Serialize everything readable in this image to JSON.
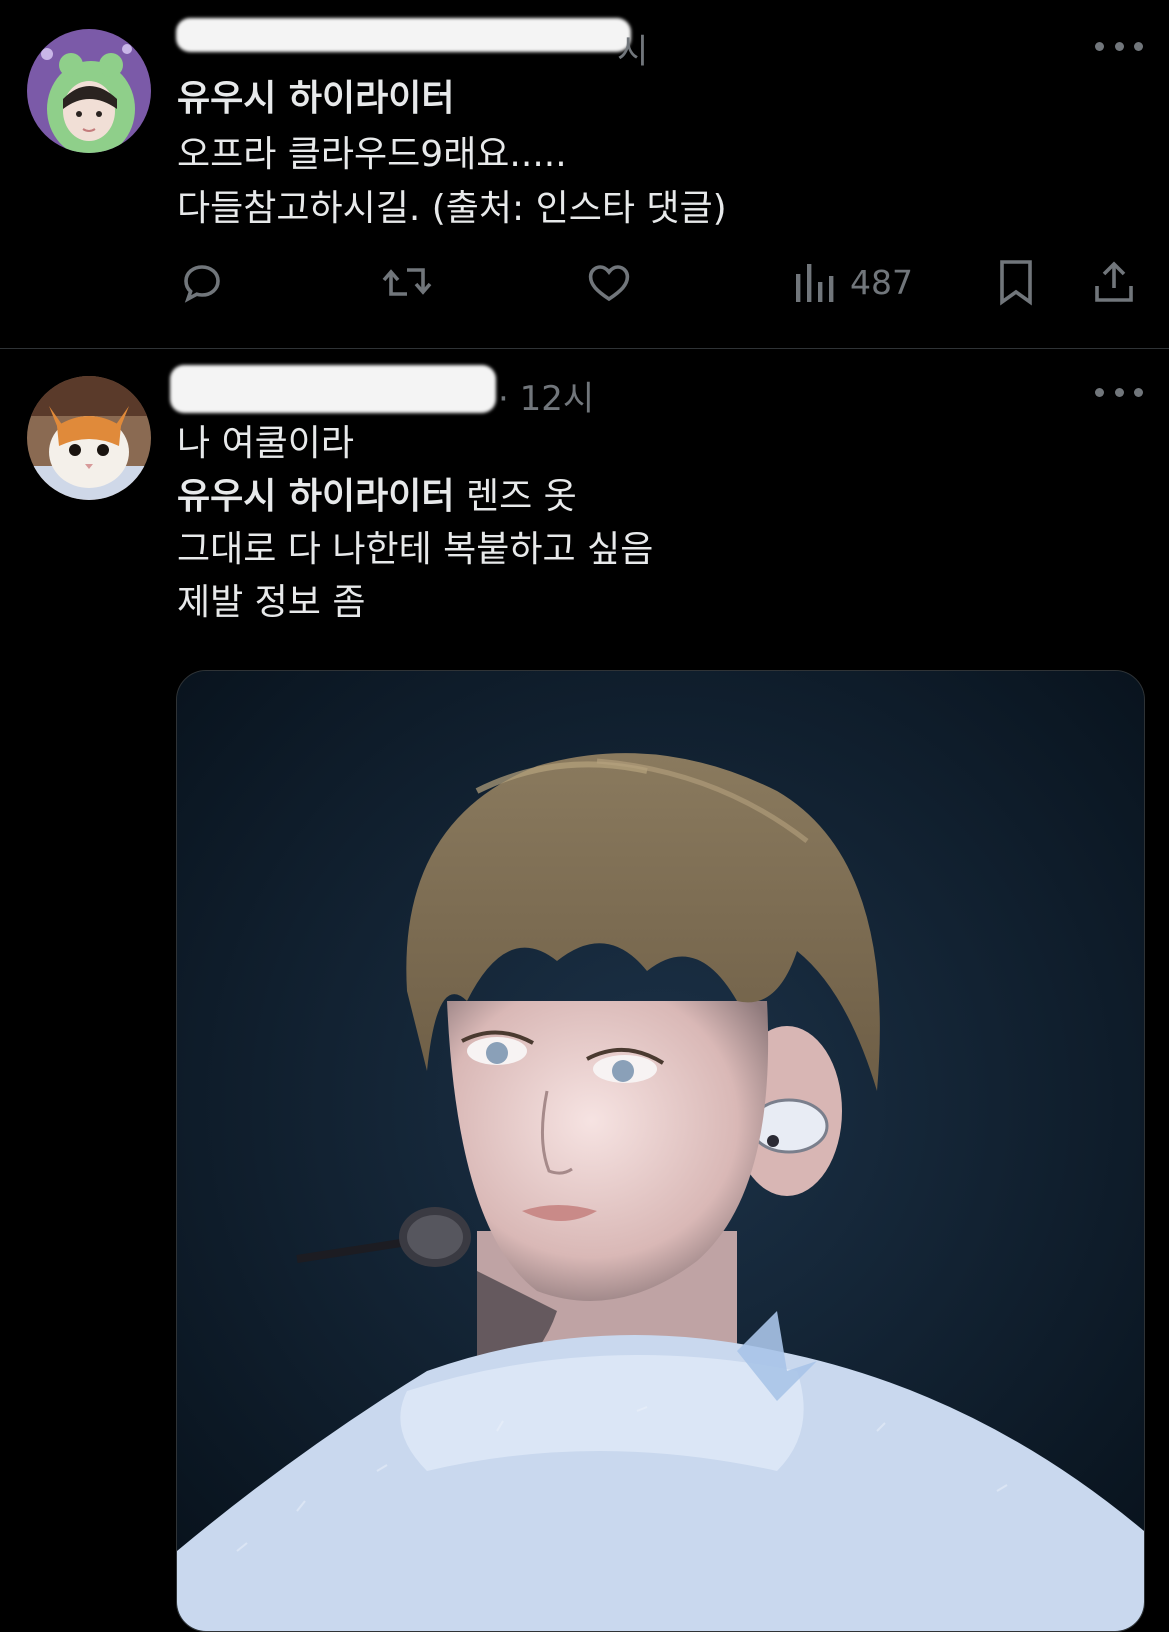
{
  "tweet1": {
    "name_line": "유우시 하이라이터",
    "body_lines": [
      "오프라 클라우드9래요.....",
      "다들참고하시길. (출처: 인스타 댓글)"
    ],
    "views": "487",
    "icons": [
      "reply-icon",
      "retweet-icon",
      "like-icon",
      "views-icon",
      "bookmark-icon",
      "share-icon"
    ]
  },
  "tweet2": {
    "time": "· 12시",
    "body_line1": "나 여쿨이라",
    "body_line2_bold": "유우시 하이라이터",
    "body_line2_rest": " 렌즈 옷",
    "body_line3": "그대로 다 나한테 복붙하고 싶음",
    "body_line4": "제발 정보 좀"
  },
  "colors": {
    "background": "#000000",
    "text": "#e7e9ea",
    "muted": "#71767b",
    "divider": "#2f3336"
  }
}
